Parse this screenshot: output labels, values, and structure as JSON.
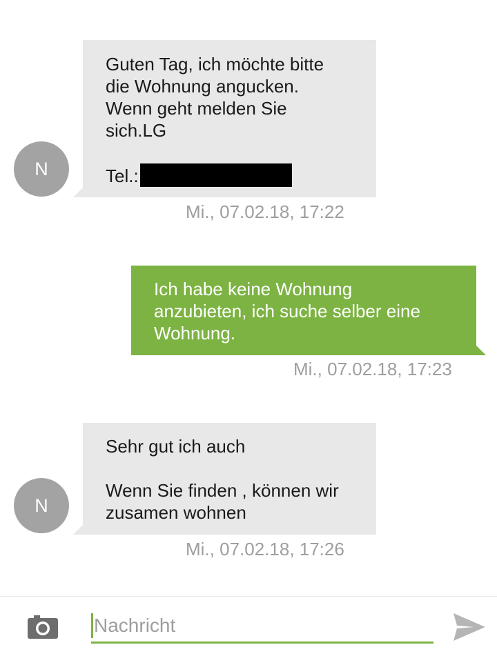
{
  "messages": [
    {
      "direction": "incoming",
      "avatar_letter": "N",
      "lines": [
        "Guten Tag, ich möchte bitte",
        "die Wohnung angucken.",
        "Wenn geht melden Sie",
        "sich.LG",
        "",
        "Tel.:"
      ],
      "redacted": true,
      "timestamp": "Mi., 07.02.18, 17:22"
    },
    {
      "direction": "outgoing",
      "lines": [
        "Ich habe keine Wohnung",
        "anzubieten, ich suche selber eine",
        "Wohnung."
      ],
      "timestamp": "Mi., 07.02.18, 17:23"
    },
    {
      "direction": "incoming",
      "avatar_letter": "N",
      "lines": [
        "Sehr gut ich auch",
        "",
        "Wenn Sie finden , können wir",
        "zusamen wohnen"
      ],
      "timestamp": "Mi., 07.02.18, 17:26"
    }
  ],
  "composer": {
    "placeholder": "Nachricht",
    "value": ""
  },
  "icons": {
    "attach": "camera-icon",
    "send": "send-icon"
  },
  "colors": {
    "outgoing_bubble": "#7cb342",
    "incoming_bubble": "#e8e8e8",
    "avatar": "#a3a3a3",
    "timestamp": "#9e9e9e",
    "accent": "#7cb342"
  }
}
